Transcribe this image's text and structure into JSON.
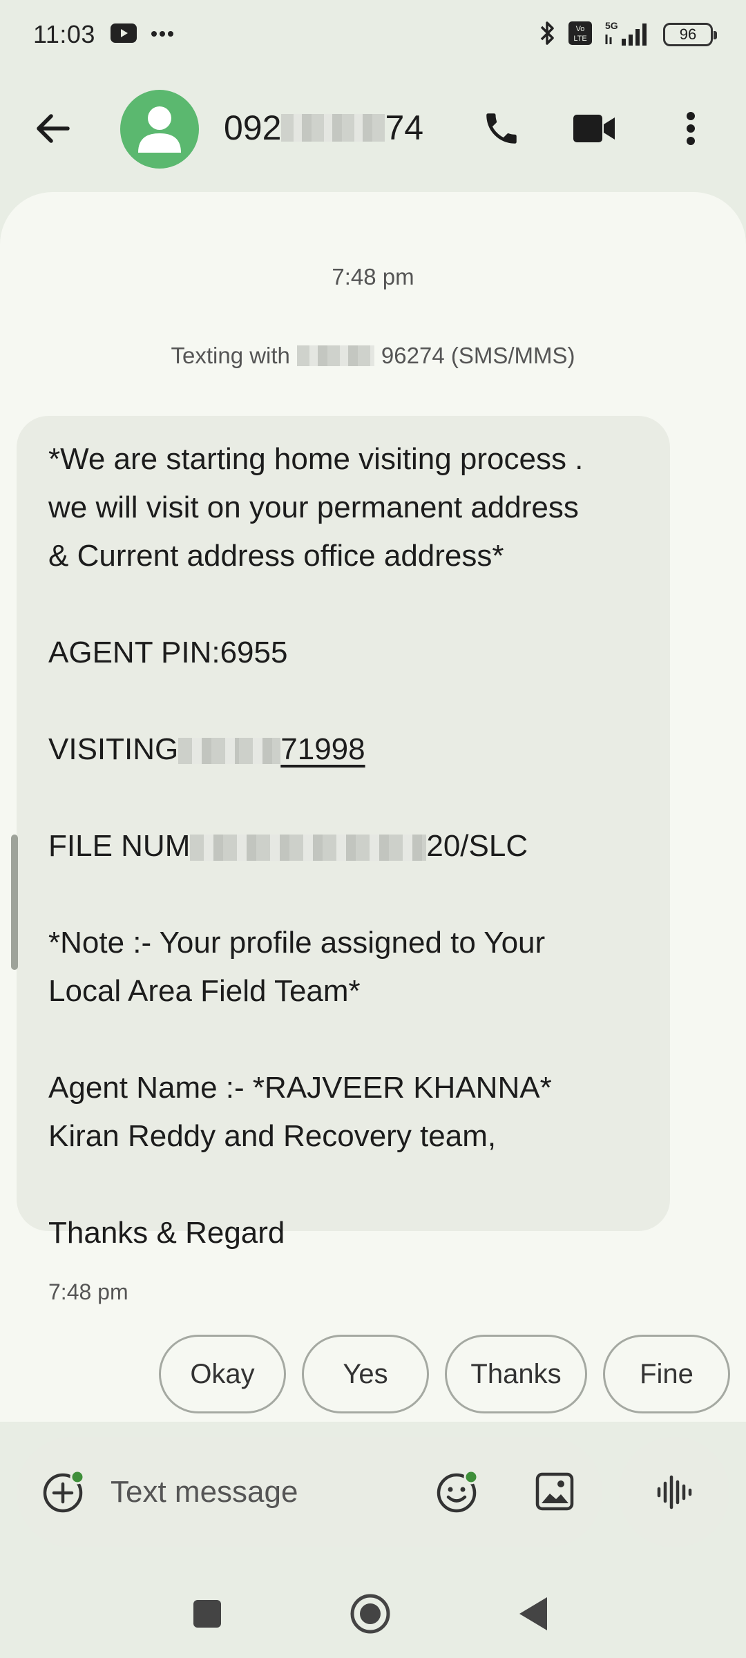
{
  "status_bar": {
    "time": "11:03",
    "battery": "96",
    "network": "5G",
    "volte": "Vo LTE"
  },
  "header": {
    "contact_prefix": "092",
    "contact_suffix": "74",
    "icons": [
      "back-arrow-icon",
      "avatar-person-icon",
      "phone-icon",
      "video-camera-icon",
      "more-vert-icon"
    ],
    "avatar_color": "#5bb86f"
  },
  "conversation": {
    "date_label": "7:48 pm",
    "texting_with_prefix": "Texting with",
    "texting_with_suffix": "96274 (SMS/MMS)",
    "message": {
      "line1": "*We are starting home visiting process .",
      "line2": "we will visit on your permanent address",
      "line3": "& Current address office address*",
      "agent_pin": "AGENT PIN:6955",
      "visiting_prefix": "VISITING",
      "visiting_suffix": "71998",
      "file_prefix": "FILE NUM",
      "file_suffix": "20/SLC",
      "note_line1": "*Note :- Your profile assigned to Your",
      "note_line2": "Local Area Field Team*",
      "agent_name": "Agent Name :- *RAJVEER KHANNA*",
      "team": "Kiran Reddy and Recovery team,",
      "thanks": "Thanks & Regard"
    },
    "time": "7:48 pm"
  },
  "smart_replies": [
    "Okay",
    "Yes",
    "Thanks",
    "Fine"
  ],
  "compose": {
    "placeholder": "Text message"
  },
  "colors": {
    "background": "#e8ede4",
    "conversation_bg": "#f6f8f2",
    "bubble": "#e9ece4",
    "badge_green": "#3f8f3a"
  }
}
